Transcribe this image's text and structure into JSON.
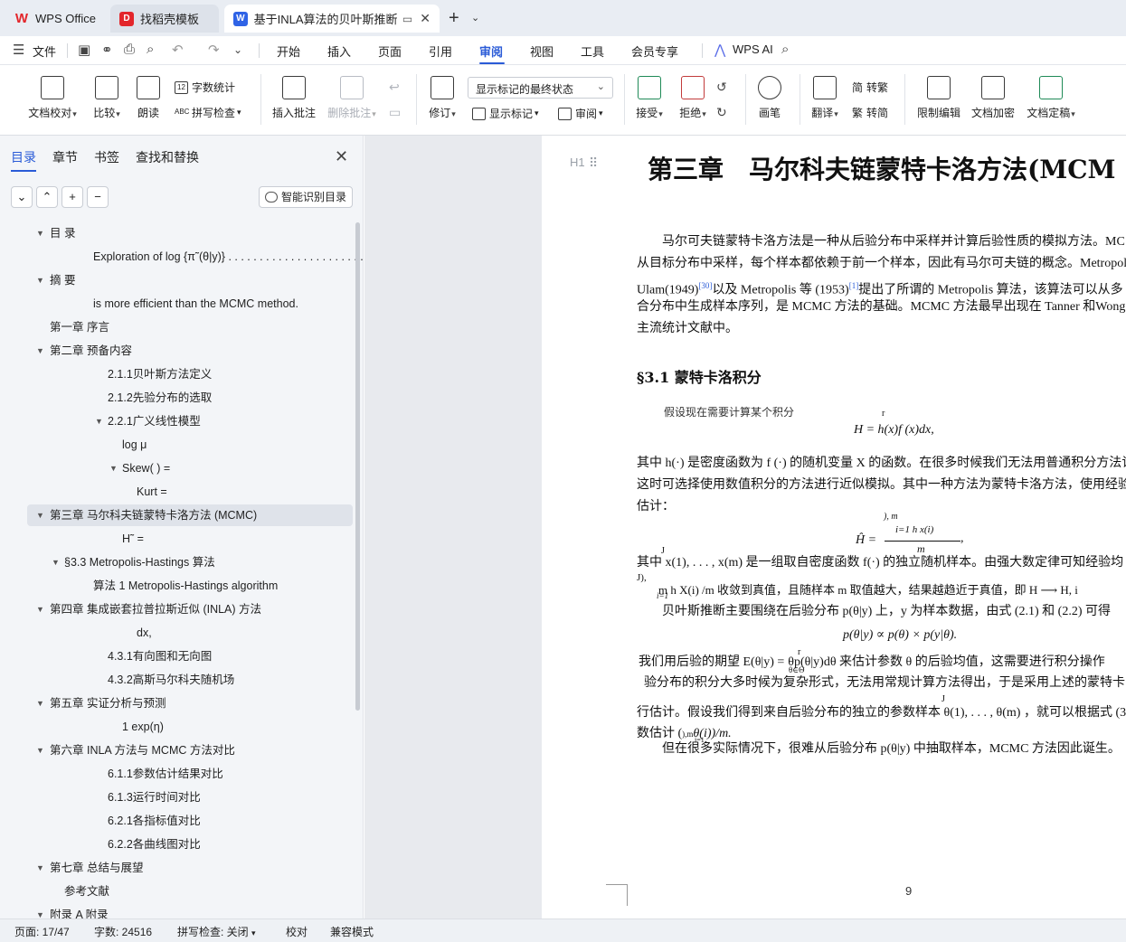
{
  "tabs": [
    {
      "label": "WPS Office"
    },
    {
      "label": "找稻壳模板"
    },
    {
      "label": "基于INLA算法的贝叶斯推断及"
    }
  ],
  "menu": {
    "file": "文件",
    "items": [
      "开始",
      "插入",
      "页面",
      "引用",
      "审阅",
      "视图",
      "工具",
      "会员专享"
    ],
    "active": "审阅",
    "ai": "WPS AI"
  },
  "ribbon": {
    "doc_check": "文档校对",
    "compare": "比较",
    "read_aloud": "朗读",
    "word_count": "字数统计",
    "spell_check": "拼写检查",
    "insert_comment": "插入批注",
    "delete_comment": "删除批注",
    "track": "修订",
    "markup_state": "显示标记的最终状态",
    "show_markup": "显示标记",
    "review": "审阅",
    "accept": "接受",
    "reject": "拒绝",
    "pen": "画笔",
    "translate": "翻译",
    "to_traditional": "转繁",
    "to_simplified": "转简",
    "restrict_edit": "限制编辑",
    "encrypt": "文档加密",
    "finalize": "文档定稿"
  },
  "nav": {
    "tabs": [
      "目录",
      "章节",
      "书签",
      "查找和替换"
    ],
    "smart_toc": "智能识别目录",
    "toc": [
      "目 录",
      "Exploration of log {π˜(θ|y)} . . . . . . . . . . . . . . . . . . . . . ...",
      "摘 要",
      "is more efficient than the MCMC method.",
      "第一章 序言",
      "第二章 预备内容",
      "2.1.1贝叶斯方法定义",
      "2.1.2先验分布的选取",
      "2.2.1广义线性模型",
      "log μ",
      "Skew( ) =",
      "Kurt =",
      "第三章 马尔科夫链蒙特卡洛方法 (MCMC)",
      "H˜ =",
      "§3.3 Metropolis-Hastings 算法",
      "算法 1 Metropolis-Hastings algorithm",
      "第四章 集成嵌套拉普拉斯近似 (INLA) 方法",
      "dx,",
      "4.3.1有向图和无向图",
      "4.3.2高斯马尔科夫随机场",
      "第五章 实证分析与预测",
      "1 exp(η)",
      "第六章 INLA 方法与 MCMC 方法对比",
      "6.1.1参数估计结果对比",
      "6.1.3运行时间对比",
      "6.2.1各指标值对比",
      "6.2.2各曲线图对比",
      "第七章 总结与展望",
      "参考文献",
      "附录 A 附录"
    ]
  },
  "document": {
    "heading_marker": "H1",
    "chapter_title": "第三章　马尔科夫链蒙特卡洛方法(MCM",
    "para1": [
      "马尔可夫链蒙特卡洛方法是一种从后验分布中采样并计算后验性质的模拟方法。MC",
      "从目标分布中采样，每个样本都依赖于前一个样本，因此有马尔可夫链的概念。Metropol",
      "Ulam(1949)",
      "[30]",
      "以及 Metropolis 等 (1953)",
      "[1]",
      "提出了所谓的 Metropolis 算法，该算法可以从多",
      "合分布中生成样本序列，是 MCMC 方法的基础。MCMC 方法最早出现在 Tanner 和Wong(",
      "主流统计文献中。"
    ],
    "section_title": "§3.1 蒙特卡洛积分",
    "assume": "假设现在需要计算某个积分",
    "eq1_r": "r",
    "eq1": "H =   h(x)f (x)dx,",
    "para2": [
      "其中 h(·) 是密度函数为 f (·) 的随机变量 X 的函数。在很多时候我们无法用普通积分方法记",
      "这时可选择使用数值积分的方法进行近似模拟。其中一种方法为蒙特卡洛方法，使用经验",
      "估计："
    ],
    "eq2_top": "), m",
    "eq2_sum": "i=1  h    x(i)",
    "eq2_lhs": "Ĥ =",
    "eq2_den": "m",
    "eq2_comma": ",",
    "para3_j": "J",
    "para3": "其中  x(1), . . . , x(m)     是一组取自密度函数 f(·) 的独立随机样本。由强大数定律可知经验均",
    "para3b_j": "J),",
    "para3b": "m   h    X(i)     /m 收敛到真值，且随样本 m 取值越大，结果越趋近于真值，即 H ⟶    H, i",
    "para3b_sub": "i=1",
    "para4": "贝叶斯推断主要围绕在后验分布 p(θ|y) 上，y 为样本数据，由式 (2.1) 和 (2.2) 可得",
    "eq3": "p(θ|y) ∝ p(θ) × p(y|θ).",
    "eq4_r": "r",
    "para5a": "我们用后验的期望 E(θ|y) =",
    "para5a_sub": "θ∈Θ",
    "para5b": "θp(θ|y)dθ 来估计参数 θ 的后验均值，这需要进行积分操作",
    "para5c": "验分布的积分大多时候为复杂形式，无法用常规计算方法得出，于是采用上述的蒙特卡",
    "para5d_j": "J",
    "para5d": "行估计。假设我们得到来自后验分布的独立的参数样本   θ(1), . . . , θ(m)    ，就可以根据式 (3",
    "para5e": "数估计 (",
    "para5e_mid": "),m",
    "para5e_b": "θ(i))/m.",
    "para5e_sub": "i=1",
    "para6": "但在很多实际情况下，很难从后验分布 p(θ|y) 中抽取样本，MCMC 方法因此诞生。",
    "page_number": "9"
  },
  "status": {
    "page": "页面: 17/47",
    "words": "字数: 24516",
    "spell": "拼写检查: 关闭",
    "proof": "校对",
    "compat": "兼容模式"
  },
  "colors": {
    "accent": "#2a5bd7",
    "wps_red": "#e3262b",
    "nav_bg": "#f3f5f8",
    "canvas_bg": "#e8eaee"
  }
}
